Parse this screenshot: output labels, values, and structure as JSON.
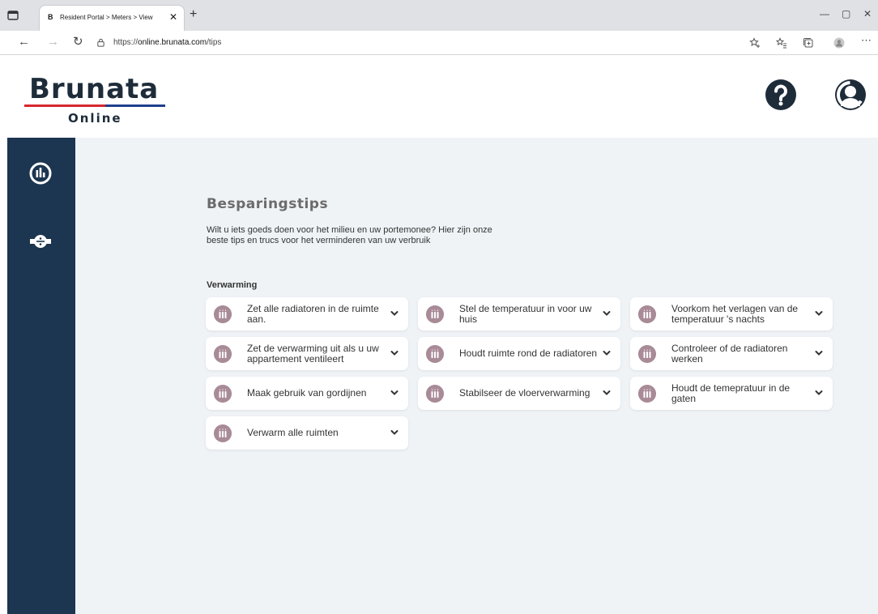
{
  "browser": {
    "tab_title": "Resident Portal > Meters > View",
    "tab_favicon_letter": "B",
    "url_prefix": "https://",
    "url_host": "online.brunata.com",
    "url_path": "/tips"
  },
  "header": {
    "logo_text": "Brunata",
    "logo_subtext": "Online",
    "help_icon": "question-circle-icon",
    "account_icon": "user-icon"
  },
  "sidebar": {
    "items": [
      {
        "name": "consumption",
        "icon": "bar-chart-circle-icon"
      },
      {
        "name": "meters",
        "icon": "pipe-meter-icon"
      }
    ]
  },
  "main": {
    "title": "Besparingstips",
    "intro": "Wilt u iets goeds doen voor het milieu en uw portemonee? Hier zijn onze beste tips en trucs voor het verminderen van uw verbruik",
    "section_title": "Verwarming",
    "tips": [
      {
        "label": "Zet alle radiatoren in de ruimte aan.",
        "icon": "radiator-icon"
      },
      {
        "label": "Stel de temperatuur in voor uw huis",
        "icon": "radiator-icon"
      },
      {
        "label": "Voorkom het verlagen van de temperatuur 's nachts",
        "icon": "radiator-icon"
      },
      {
        "label": "Zet de verwarming uit als u uw appartement ventileert",
        "icon": "radiator-icon"
      },
      {
        "label": "Houdt ruimte rond de radiatoren",
        "icon": "radiator-icon"
      },
      {
        "label": "Controleer of de radiatoren werken",
        "icon": "radiator-icon"
      },
      {
        "label": "Maak gebruik van gordijnen",
        "icon": "radiator-icon"
      },
      {
        "label": "Stabilseer de vloerverwarming",
        "icon": "radiator-icon"
      },
      {
        "label": "Houdt de temepratuur in de gaten",
        "icon": "radiator-icon"
      },
      {
        "label": "Verwarm alle ruimten",
        "icon": "radiator-icon"
      }
    ]
  },
  "colors": {
    "sidebar": "#1c3550",
    "content_bg": "#eff3f6",
    "tip_icon": "#a88b97",
    "logo_red": "#d7262e",
    "logo_blue": "#1f3e8c"
  }
}
